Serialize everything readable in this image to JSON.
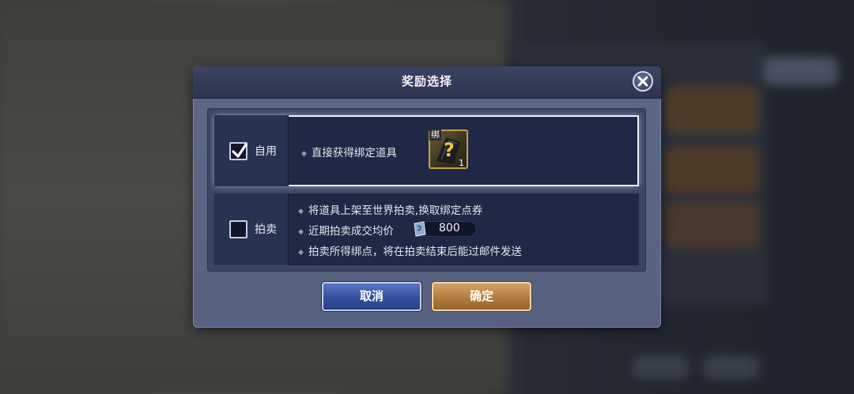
{
  "dialog": {
    "title": "奖励选择",
    "options": [
      {
        "label": "自用",
        "checked": true,
        "lines": [
          "直接获得绑定道具"
        ],
        "item": {
          "tag": "绑",
          "count": "1",
          "icon": "mystery-box-icon"
        }
      },
      {
        "label": "拍卖",
        "checked": false,
        "lines": [
          "将道具上架至世界拍卖,换取绑定点券",
          "近期拍卖成交均价",
          "拍卖所得绑点，将在拍卖结束后能过邮件发送"
        ],
        "price": "800",
        "price_icon": "coupon-icon"
      }
    ],
    "buttons": {
      "cancel": "取消",
      "confirm": "确定"
    }
  },
  "colors": {
    "accent_gold": "#c5a04a",
    "panel_bg": "#1f2844",
    "header_bg": "#2c3450"
  }
}
